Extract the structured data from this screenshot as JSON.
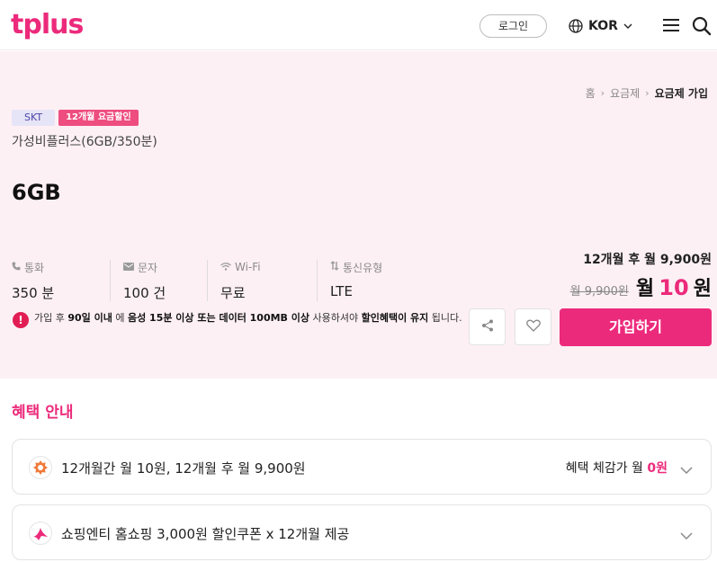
{
  "header": {
    "logo": "tplus",
    "login_label": "로그인",
    "language": "KOR"
  },
  "breadcrumb": [
    "홈",
    "요금제",
    "요금제 가입"
  ],
  "plan": {
    "carrier_badge": "SKT",
    "promo_badge": "12개월 요금할인",
    "name": "가성비플러스(6GB/350분)",
    "data": "6GB",
    "specs": [
      {
        "label": "통화",
        "value": "350 분",
        "icon": "phone-icon"
      },
      {
        "label": "문자",
        "value": "100 건",
        "icon": "mail-icon"
      },
      {
        "label": "Wi-Fi",
        "value": "무료",
        "icon": "wifi-icon"
      },
      {
        "label": "통신유형",
        "value": "LTE",
        "icon": "signal-icon"
      }
    ]
  },
  "price": {
    "after_label": "12개월 후 월 9,900원",
    "old": "월 9,900원",
    "month_prefix": "월",
    "amount": "10",
    "unit": "원"
  },
  "notice": {
    "p1": "가입 후 ",
    "b1": "90일 이내",
    "p2": " 에 ",
    "b2": "음성 15분 이상 또는 데이터 100MB 이상",
    "p3": " 사용하셔야 ",
    "b3": "할인혜택이 유지",
    "p4": " 됩니다."
  },
  "actions": {
    "join_label": "가입하기"
  },
  "benefits": {
    "title": "혜택 안내",
    "items": [
      {
        "text": "12개월간 월 10원, 12개월 후 월 9,900원",
        "right_prefix": "혜택 체감가 월 ",
        "right_value": "0원"
      },
      {
        "text": "쇼핑엔티 홈쇼핑 3,000원 할인쿠폰 x 12개월 제공"
      }
    ]
  },
  "colors": {
    "brand": "#ec2a7b",
    "hero_bg": "#fdf0f4",
    "warning": "#e11d54"
  }
}
